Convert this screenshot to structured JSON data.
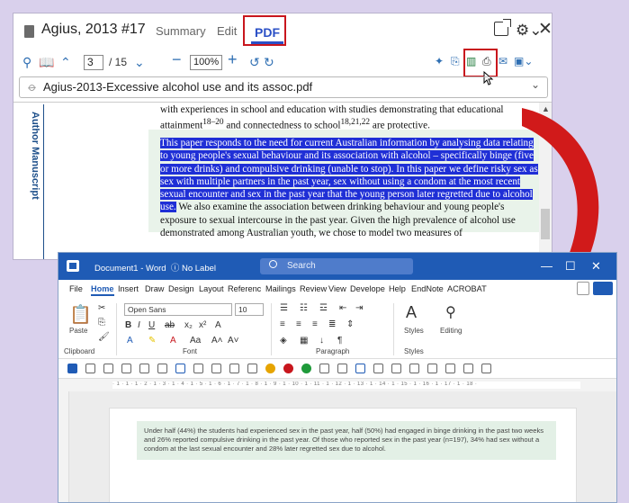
{
  "pdf_window": {
    "title": "Agius, 2013 #17",
    "tabs": {
      "summary": "Summary",
      "edit": "Edit",
      "pdf": "PDF"
    },
    "page_current": "3",
    "page_total": "/ 15",
    "zoom": "100%",
    "file_name": "Agius-2013-Excessive alcohol use and its assoc.pdf",
    "side_label": "Author Manuscript",
    "text_top": "with experiences in school and education with studies demonstrating that educational attainment",
    "sup_1": "18–20",
    "text_top_mid": " and connectedness to school",
    "sup_2": "18,21,22",
    "text_top_end": " are protective.",
    "highlighted_text": "This paper responds to the need for current Australian information by analysing data relating to young people's sexual behaviour and its association with alcohol – specifically binge (five or more drinks) and compulsive drinking (unable to stop). In this paper we define risky sex as sex with multiple partners in the past year, sex without using a condom at the most recent sexual encounter and sex in the past year that the young person later regretted due to alcohol use.",
    "normal_text": " We also examine the association between drinking behaviour and young people's exposure to sexual intercourse in the past year. Given the high prevalence of alcohol use demonstrated among Australian youth, we chose to model two measures of"
  },
  "word_window": {
    "doc_title": "Document1 - Word",
    "label": "No Label",
    "search_placeholder": "Search",
    "menu": [
      "File",
      "Home",
      "Insert",
      "Draw",
      "Design",
      "Layout",
      "Referenc",
      "Mailings",
      "Review",
      "View",
      "Develope",
      "Help",
      "EndNote",
      "ACROBAT"
    ],
    "font_name": "Open Sans",
    "font_size": "10",
    "groups": {
      "clipboard": "Clipboard",
      "font": "Font",
      "paragraph": "Paragraph",
      "styles": "Styles",
      "editing": "Editing",
      "paste": "Paste",
      "styles_group": "Styles"
    },
    "ruler": "· 1 · 1 · 1 · 2 · 1 · 3 · 1 · 4 · 1 · 5 · 1 · 6 · 1 · 7 · 1 · 8 · 1 · 9 · 1 · 10 · 1 · 11 · 1 · 12 · 1 · 13 · 1 · 14 · 1 · 15 · 1 · 16 · 1 · 17 · 1 · 18 ·",
    "body_text": "Under half (44%) the students had experienced sex in the past year, half (50%) had engaged in binge drinking in the past two weeks and 26% reported compulsive drinking in the past year. Of those who reported sex in the past year (n=197), 34% had sex without a condom at the last sexual encounter and 28% later regretted sex due to alcohol."
  },
  "colors": {
    "accent": "#1f5bb5",
    "highlight": "#1f2fd6",
    "red_box": "#c8161d",
    "arrow": "#d11a1a"
  }
}
